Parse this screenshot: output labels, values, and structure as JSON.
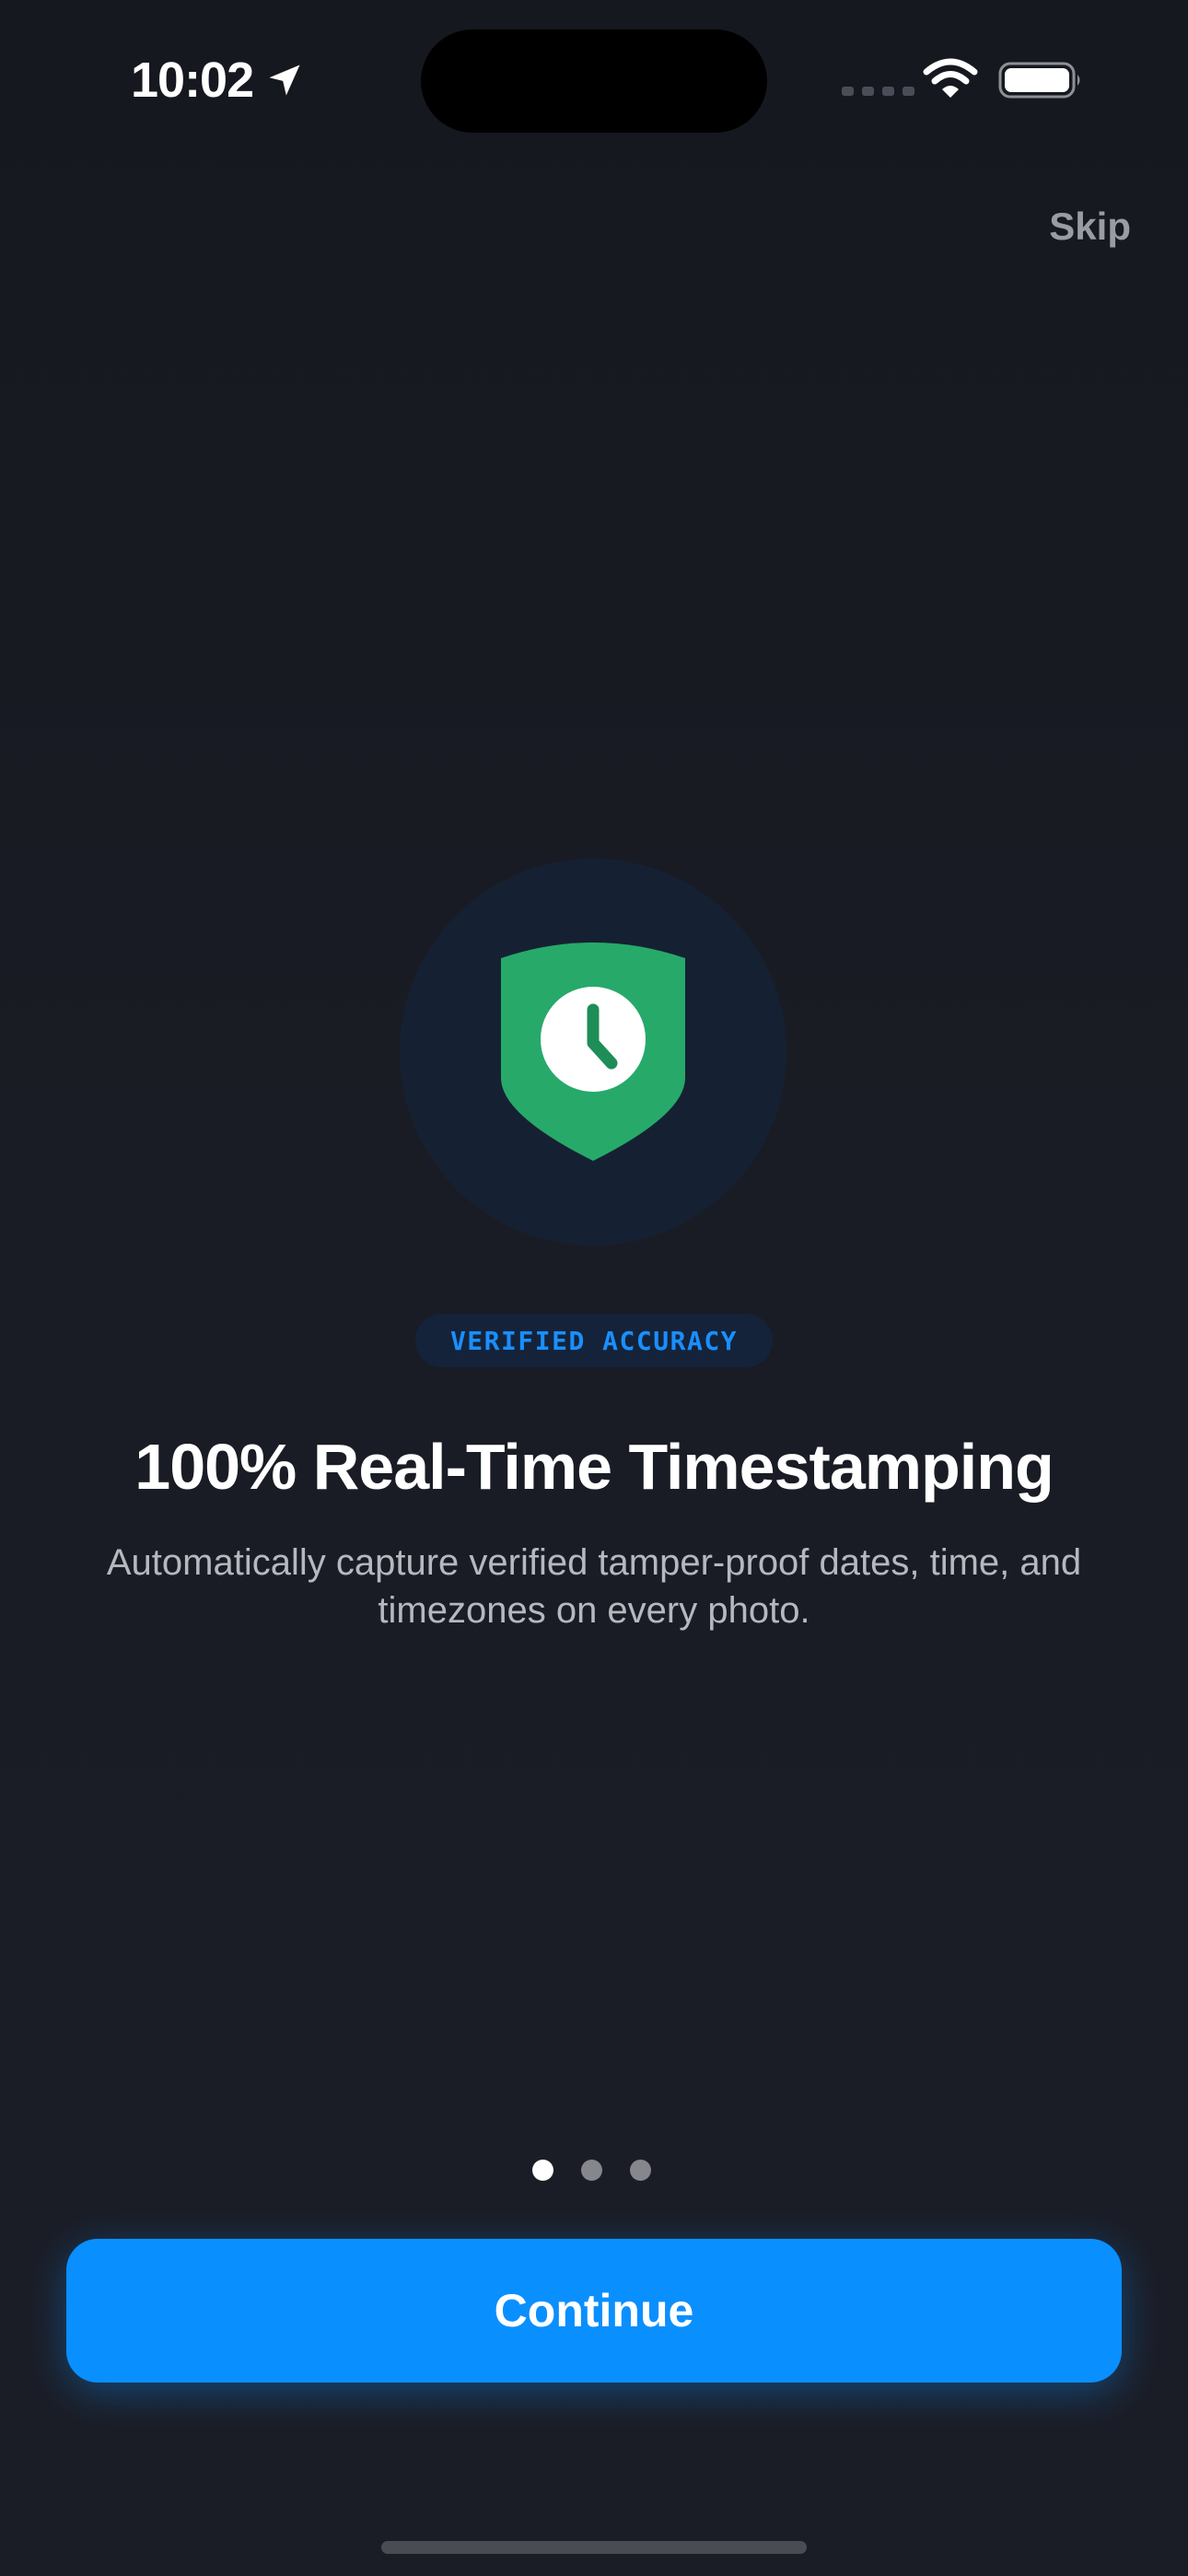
{
  "status_bar": {
    "time": "10:02"
  },
  "onboarding": {
    "skip_label": "Skip",
    "badge": "VERIFIED ACCURACY",
    "headline": "100% Real-Time Timestamping",
    "subtitle": "Automatically capture verified tamper-proof dates, time, and timezones on every photo.",
    "page_total": 3,
    "page_current": 1,
    "continue_label": "Continue"
  },
  "icons": {
    "location": "location-arrow-icon",
    "wifi": "wifi-icon",
    "battery": "battery-icon",
    "signal": "cellular-signal-icon",
    "hero": "shield-clock-icon"
  },
  "colors": {
    "background": "#181a22",
    "accent": "#0a8ffe",
    "shield_green": "#27a96a",
    "badge_text": "#1a8fff"
  }
}
